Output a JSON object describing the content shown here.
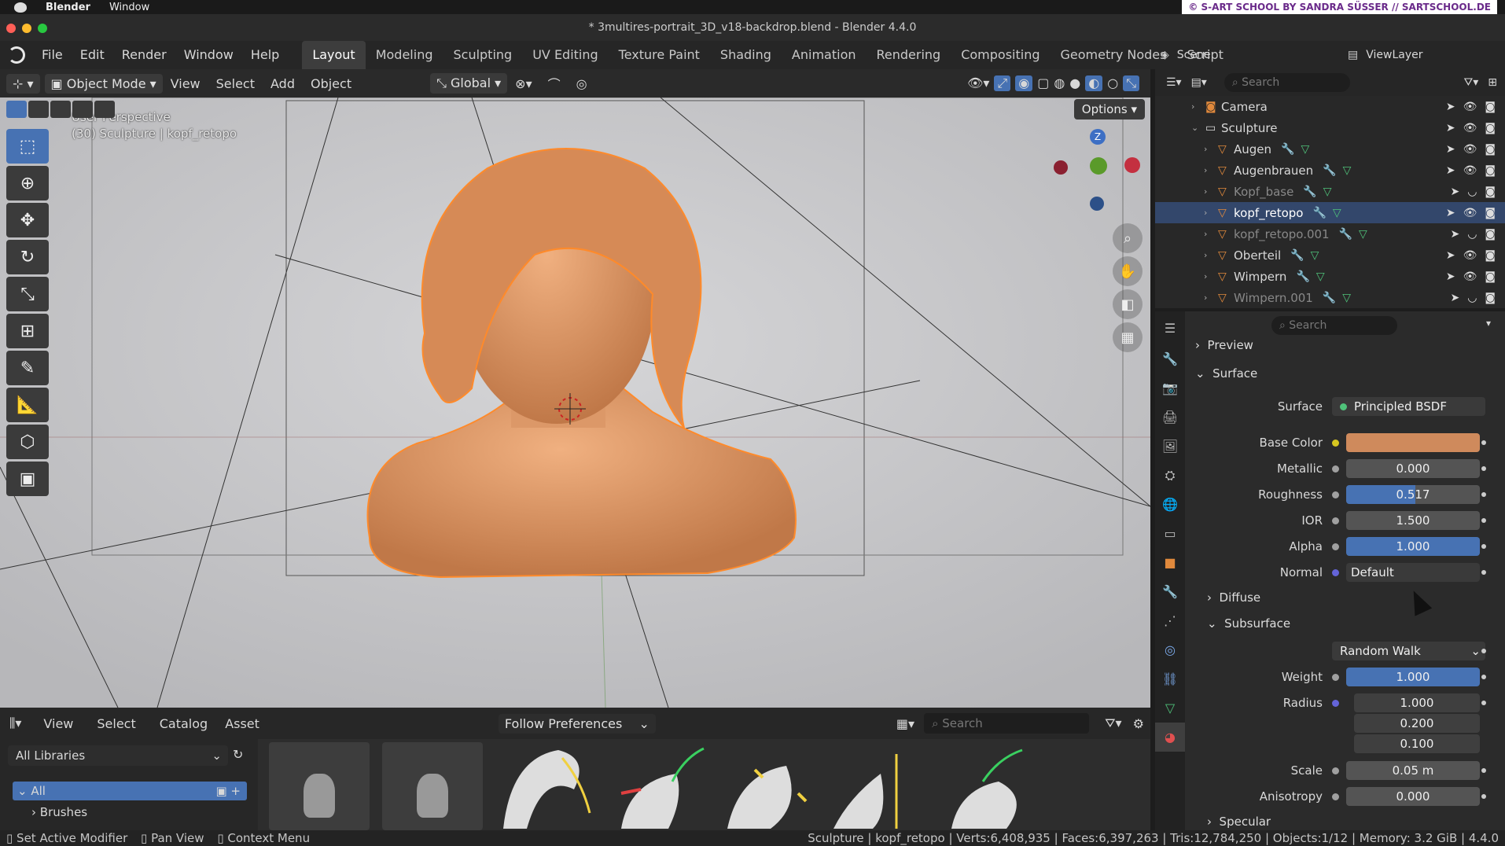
{
  "macos": {
    "app": "Blender",
    "menu": "Window",
    "watermark": "© S-ART SCHOOL BY SANDRA SÜSSER // SARTSCHOOL.DE"
  },
  "title": "* 3multires-portrait_3D_v18-backdrop.blend - Blender 4.4.0",
  "menubar": [
    "File",
    "Edit",
    "Render",
    "Window",
    "Help"
  ],
  "workspaces": [
    "Layout",
    "Modeling",
    "Sculpting",
    "UV Editing",
    "Texture Paint",
    "Shading",
    "Animation",
    "Rendering",
    "Compositing",
    "Geometry Nodes",
    "Script"
  ],
  "scene": {
    "label": "Scene",
    "viewlayer": "ViewLayer"
  },
  "viewport_header": {
    "mode": "Object Mode",
    "view": "View",
    "select": "Select",
    "add": "Add",
    "object": "Object",
    "orientation": "Global",
    "options": "Options"
  },
  "viewport": {
    "perspective": "User Perspective",
    "context": "(30) Sculpture | kopf_retopo",
    "gizmo_z": "Z"
  },
  "outliner": {
    "search_placeholder": "Search",
    "rows": [
      {
        "name": "Camera",
        "indent": 1,
        "dim": false
      },
      {
        "name": "Sculpture",
        "indent": 1,
        "dim": false
      },
      {
        "name": "Augen",
        "indent": 2,
        "dim": false
      },
      {
        "name": "Augenbrauen",
        "indent": 2,
        "dim": false
      },
      {
        "name": "Kopf_base",
        "indent": 2,
        "dim": true
      },
      {
        "name": "kopf_retopo",
        "indent": 2,
        "dim": false,
        "selected": true
      },
      {
        "name": "kopf_retopo.001",
        "indent": 2,
        "dim": true
      },
      {
        "name": "Oberteil",
        "indent": 2,
        "dim": false
      },
      {
        "name": "Wimpern",
        "indent": 2,
        "dim": false
      },
      {
        "name": "Wimpern.001",
        "indent": 2,
        "dim": true
      }
    ]
  },
  "properties": {
    "search_placeholder": "Search",
    "preview": "Preview",
    "surface_section": "Surface",
    "surface_label": "Surface",
    "surface_value": "Principled BSDF",
    "base_color_label": "Base Color",
    "base_color": "#cf8a5c",
    "metallic_label": "Metallic",
    "metallic": "0.000",
    "roughness_label": "Roughness",
    "roughness": "0.517",
    "ior_label": "IOR",
    "ior": "1.500",
    "alpha_label": "Alpha",
    "alpha": "1.000",
    "normal_label": "Normal",
    "normal": "Default",
    "diffuse": "Diffuse",
    "subsurface": "Subsurface",
    "subsurface_method": "Random Walk",
    "weight_label": "Weight",
    "weight": "1.000",
    "radius_label": "Radius",
    "radius": [
      "1.000",
      "0.200",
      "0.100"
    ],
    "scale_label": "Scale",
    "scale": "0.05 m",
    "anisotropy_label": "Anisotropy",
    "anisotropy": "0.000",
    "specular": "Specular"
  },
  "asset_browser": {
    "view": "View",
    "select": "Select",
    "catalog": "Catalog",
    "asset": "Asset",
    "import_mode": "Follow Preferences",
    "search_placeholder": "Search",
    "library": "All Libraries",
    "tree_all": "All",
    "tree_brushes": "Brushes"
  },
  "statusbar": {
    "left1": "Set Active Modifier",
    "left2": "Pan View",
    "left3": "Context Menu",
    "stats": "Sculpture | kopf_retopo | Verts:6,408,935 | Faces:6,397,263 | Tris:12,784,250 | Objects:1/12 | Memory: 3.2 GiB | 4.4.0"
  }
}
